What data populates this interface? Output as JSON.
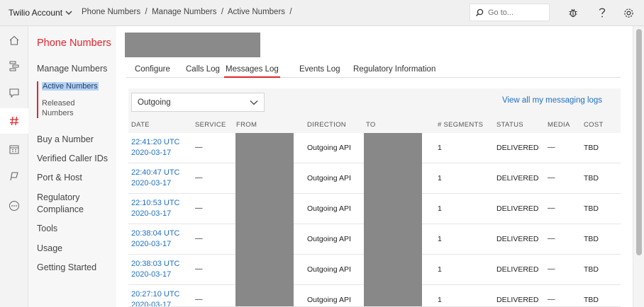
{
  "topbar": {
    "account_label": "Twilio Account",
    "breadcrumb": [
      "Phone Numbers",
      "Manage Numbers",
      "Active Numbers",
      ""
    ],
    "search_placeholder": "Go to..."
  },
  "sidenav": {
    "title": "Phone Numbers",
    "manage_numbers": "Manage Numbers",
    "sub_items": [
      "Active Numbers",
      "Released Numbers"
    ],
    "items": [
      "Buy a Number",
      "Verified Caller IDs",
      "Port & Host",
      "Regulatory Compliance",
      "Tools",
      "Usage",
      "Getting Started"
    ]
  },
  "tabs": [
    "Configure",
    "Calls Log",
    "Messages Log",
    "Events Log",
    "Regulatory Information"
  ],
  "active_tab": "Messages Log",
  "filter": {
    "selected": "Outgoing"
  },
  "view_all_link": "View all my messaging logs",
  "table": {
    "columns": [
      "DATE",
      "SERVICE",
      "FROM",
      "DIRECTION",
      "TO",
      "# SEGMENTS",
      "STATUS",
      "MEDIA",
      "COST"
    ],
    "rows": [
      {
        "time": "22:41:20 UTC",
        "date": "2020-03-17",
        "service": "—",
        "direction": "Outgoing API",
        "segments": "1",
        "status": "DELIVERED",
        "media": "—",
        "cost": "TBD"
      },
      {
        "time": "22:40:47 UTC",
        "date": "2020-03-17",
        "service": "—",
        "direction": "Outgoing API",
        "segments": "1",
        "status": "DELIVERED",
        "media": "—",
        "cost": "TBD"
      },
      {
        "time": "22:10:53 UTC",
        "date": "2020-03-17",
        "service": "—",
        "direction": "Outgoing API",
        "segments": "1",
        "status": "DELIVERED",
        "media": "—",
        "cost": "TBD"
      },
      {
        "time": "20:38:04 UTC",
        "date": "2020-03-17",
        "service": "—",
        "direction": "Outgoing API",
        "segments": "1",
        "status": "DELIVERED",
        "media": "—",
        "cost": "TBD"
      },
      {
        "time": "20:38:03 UTC",
        "date": "2020-03-17",
        "service": "—",
        "direction": "Outgoing API",
        "segments": "1",
        "status": "DELIVERED",
        "media": "—",
        "cost": "TBD"
      },
      {
        "time": "20:27:10 UTC",
        "date": "2020-03-17",
        "service": "—",
        "direction": "Outgoing API",
        "segments": "1",
        "status": "DELIVERED",
        "media": "—",
        "cost": "TBD"
      }
    ]
  },
  "colors": {
    "brand_red": "#e1242f",
    "link_blue": "#1f6fc5",
    "redaction": "#888888"
  },
  "icons": [
    "home-icon",
    "flow-icon",
    "chat-icon",
    "hash-icon",
    "building-icon",
    "flag-icon",
    "more-icon",
    "bug-icon",
    "help-icon",
    "gear-icon",
    "search-icon",
    "chevron-down-icon"
  ]
}
